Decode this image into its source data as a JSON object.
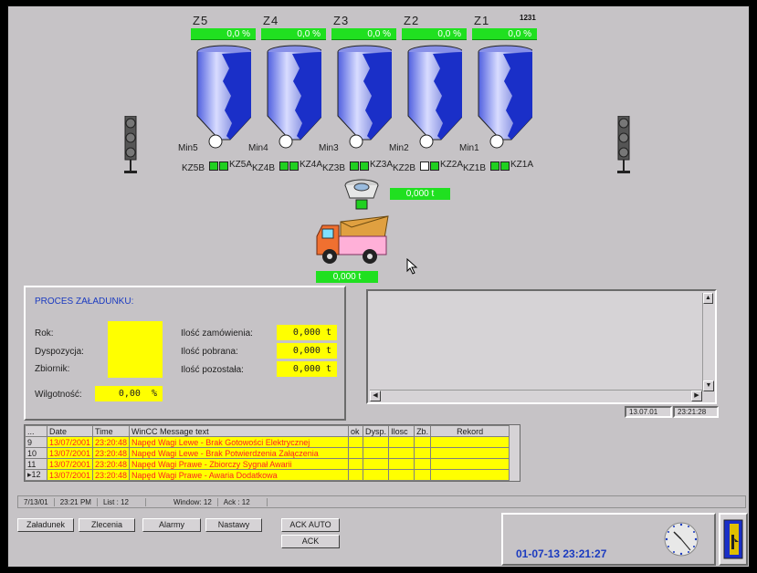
{
  "silos": [
    {
      "zone": "Z5",
      "percent": "0,0 %",
      "min_label": "Min5",
      "valve_left": "KZ5B",
      "valve_right": "KZ5A",
      "extra": ""
    },
    {
      "zone": "Z4",
      "percent": "0,0 %",
      "min_label": "Min4",
      "valve_left": "KZ4B",
      "valve_right": "KZ4A",
      "extra": ""
    },
    {
      "zone": "Z3",
      "percent": "0,0 %",
      "min_label": "Min3",
      "valve_left": "KZ3B",
      "valve_right": "KZ3A",
      "extra": ""
    },
    {
      "zone": "Z2",
      "percent": "0,0 %",
      "min_label": "Min2",
      "valve_left": "KZ2B",
      "valve_right": "KZ2A",
      "extra": ""
    },
    {
      "zone": "Z1",
      "percent": "0,0 %",
      "min_label": "Min1",
      "valve_left": "KZ1B",
      "valve_right": "KZ1A",
      "extra": "1231"
    }
  ],
  "scale_weight": "0,000 t",
  "truck_weight": "0,000 t",
  "process": {
    "title": "PROCES ZAŁADUNKU:",
    "rok_label": "Rok:",
    "dyspozycja_label": "Dyspozycja:",
    "zbiornik_label": "Zbiornik:",
    "wilgotnosc_label": "Wilgotność:",
    "wilgotnosc_value": "0,00",
    "wilgotnosc_unit": "%",
    "zamowienia_label": "Ilość zamówienia:",
    "zamowienia_value": "0,000",
    "pobrana_label": "Ilość pobrana:",
    "pobrana_value": "0,000",
    "pozostala_label": "Ilość pozostała:",
    "pozostala_value": "0,000",
    "unit_t": "t"
  },
  "trend": {
    "date": "13.07.01",
    "time": "23:21:28"
  },
  "messages": {
    "headers": [
      "...",
      "Date",
      "Time",
      "WinCC Message text",
      "ok",
      "Dysp.",
      "Ilosc",
      "Zb.",
      "Rekord"
    ],
    "rows": [
      {
        "num": "9",
        "date": "13/07/2001",
        "time": "23:20:48",
        "text": "Napęd Wagi Lewe - Brak Gotowości Elektrycznej"
      },
      {
        "num": "10",
        "date": "13/07/2001",
        "time": "23:20:48",
        "text": "Napęd Wagi Lewe - Brak Potwierdzenia Załączenia"
      },
      {
        "num": "11",
        "date": "13/07/2001",
        "time": "23:20:48",
        "text": "Napęd Wagi Prawe - Zbiorczy Sygnał Awarii"
      },
      {
        "num": "▸12",
        "date": "13/07/2001",
        "time": "23:20:48",
        "text": "Napęd Wagi Prawe - Awaria Dodatkowa"
      }
    ]
  },
  "status": {
    "date": "7/13/01",
    "time": "23:21 PM",
    "list": "List : 12",
    "window": "Window: 12",
    "ack": "Ack : 12"
  },
  "buttons": {
    "zaladunek": "Załadunek",
    "zlecenia": "Zlecenia",
    "alarmy": "Alarmy",
    "nastawy": "Nastawy",
    "ack_auto": "ACK AUTO",
    "ack": "ACK"
  },
  "clock": {
    "datetime": "01-07-13 23:21:27"
  },
  "colors": {
    "panel_bg": "#c6c3c6",
    "green_indicator": "#20e020",
    "yellow_field": "#ffff00",
    "alarm_text": "#ff2020",
    "silo_blue": "#1a2fc8"
  }
}
